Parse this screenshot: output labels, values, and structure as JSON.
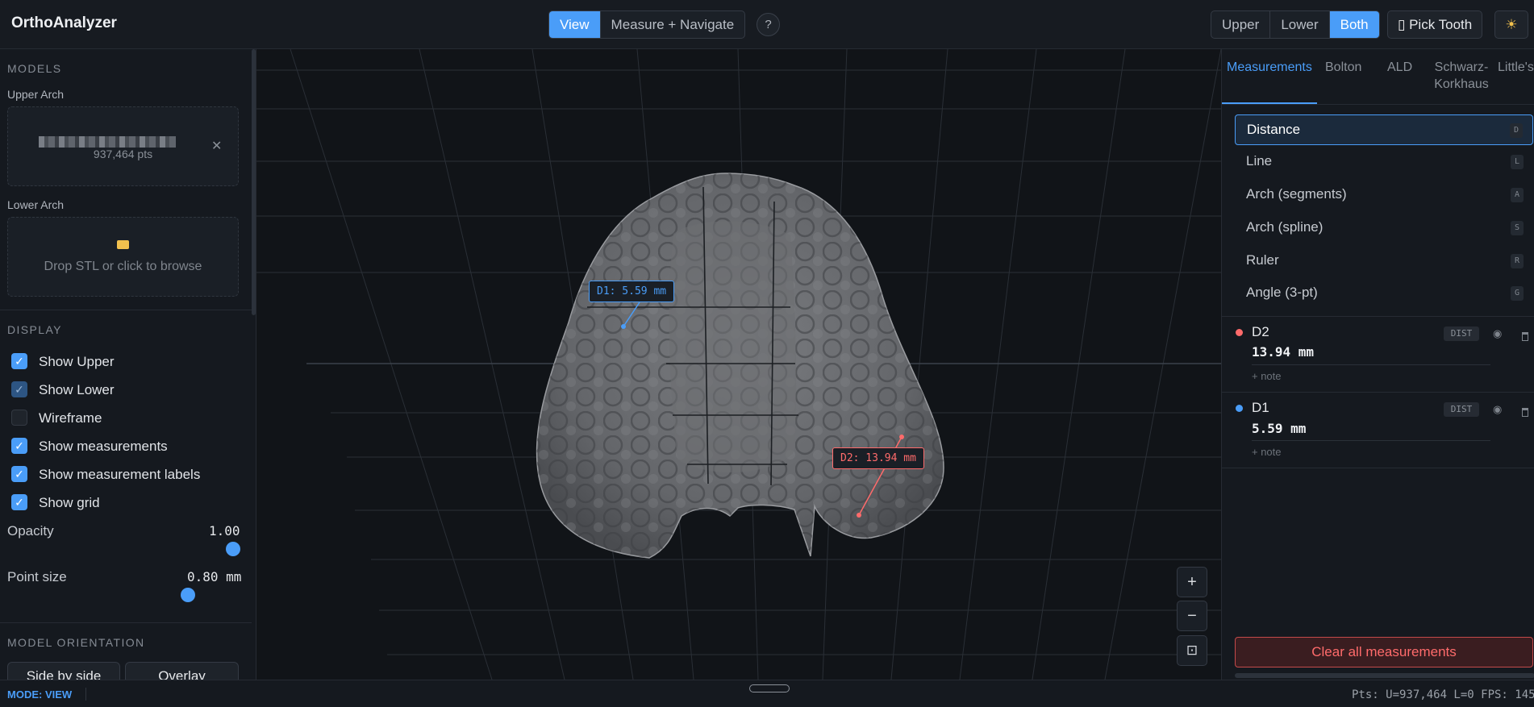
{
  "app": {
    "title": "OrthoAnalyzer"
  },
  "header": {
    "mode_tabs": [
      "View",
      "Measure + Navigate"
    ],
    "active_mode": "View",
    "help_label": "?",
    "arch_tabs": [
      "Upper",
      "Lower",
      "Both"
    ],
    "active_arch": "Both",
    "pick_tooth_label": "Pick Tooth",
    "pick_tooth_icon": "tooth-icon",
    "theme_icon": "sun-icon"
  },
  "sidebar": {
    "models_title": "MODELS",
    "upper_arch": {
      "label": "Upper Arch",
      "pts": "937,464 pts",
      "remove_label": "✕"
    },
    "lower_arch": {
      "label": "Lower Arch",
      "drop_text": "Drop STL or click to browse"
    },
    "display_title": "DISPLAY",
    "checkboxes": [
      {
        "label": "Show Upper",
        "checked": true
      },
      {
        "label": "Show Lower",
        "checked": true
      },
      {
        "label": "Wireframe",
        "checked": false
      },
      {
        "label": "Show measurements",
        "checked": true
      },
      {
        "label": "Show measurement labels",
        "checked": true
      },
      {
        "label": "Show grid",
        "checked": true
      }
    ],
    "opacity": {
      "label": "Opacity",
      "value": "1.00",
      "fraction": 1.0
    },
    "point_size": {
      "label": "Point size",
      "value": "0.80 mm",
      "fraction": 0.78
    },
    "orientation_title": "MODEL ORIENTATION",
    "orientation_buttons": [
      "Side by side",
      "Overlay"
    ]
  },
  "viewport": {
    "labels": [
      {
        "text": "D1: 5.59 mm",
        "color": "#4a9df8"
      },
      {
        "text": "D2: 13.94 mm",
        "color": "#ff6b6b"
      }
    ],
    "zoom_in": "+",
    "zoom_out": "−",
    "fit": "⊡"
  },
  "right_panel": {
    "tabs": [
      "Measurements",
      "Bolton",
      "ALD",
      "Schwarz-Korkhaus",
      "Little's"
    ],
    "active_tab": "Measurements",
    "tools": [
      {
        "label": "Distance",
        "key": "D"
      },
      {
        "label": "Line",
        "key": "L"
      },
      {
        "label": "Arch (segments)",
        "key": "A"
      },
      {
        "label": "Arch (spline)",
        "key": "S"
      },
      {
        "label": "Ruler",
        "key": "R"
      },
      {
        "label": "Angle (3-pt)",
        "key": "G"
      }
    ],
    "selected_tool": "Distance",
    "measurements": [
      {
        "name": "D2",
        "value": "13.94 mm",
        "type": "DIST",
        "note": "+ note",
        "color": "#ff6b6b"
      },
      {
        "name": "D1",
        "value": "5.59 mm",
        "type": "DIST",
        "note": "+ note",
        "color": "#4a9df8"
      }
    ],
    "clear_label": "Clear all measurements"
  },
  "status": {
    "mode": "MODE: VIEW",
    "stats": "Pts: U=937,464 L=0 FPS: 145"
  },
  "colors": {
    "accent": "#4a9df8",
    "danger": "#ff6b6b",
    "background": "#111418"
  }
}
